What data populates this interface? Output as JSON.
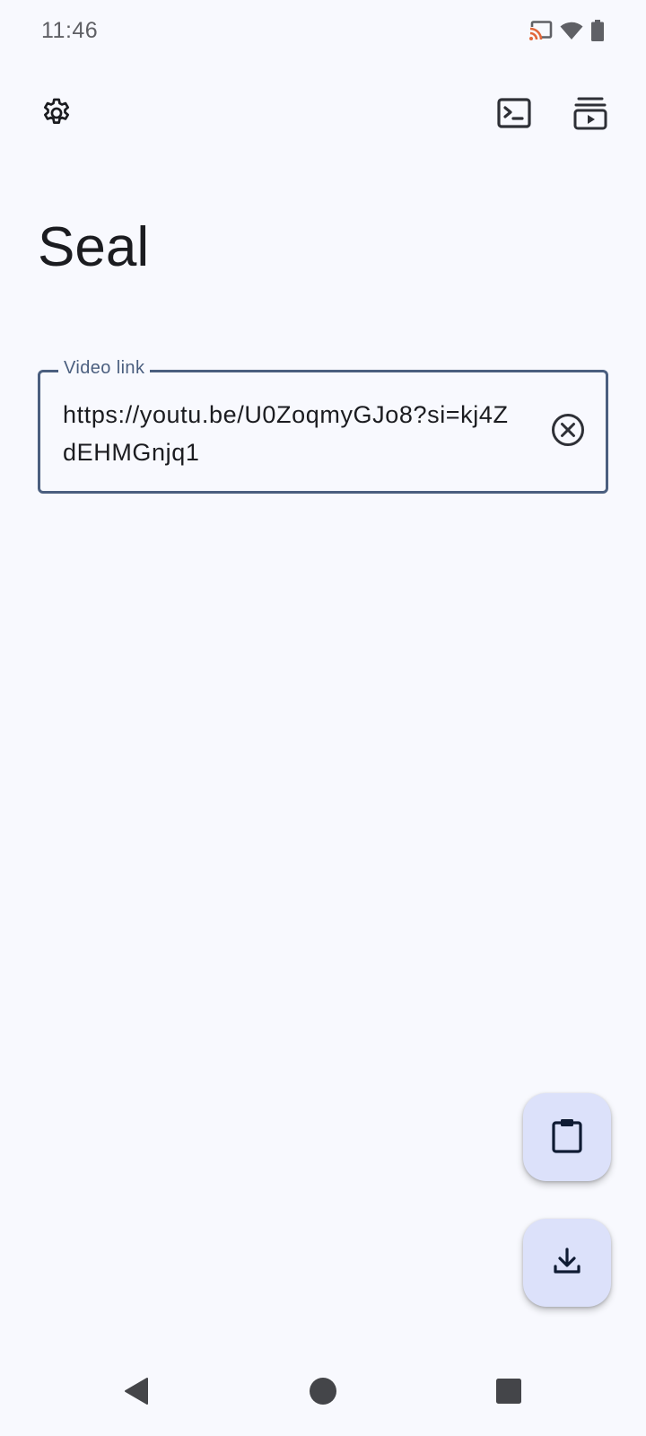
{
  "status_bar": {
    "time": "11:46",
    "icons": [
      "cast-icon",
      "wifi-icon",
      "battery-icon"
    ],
    "cast_color": "#e2673a"
  },
  "top_bar": {
    "left_icon": "gear-icon",
    "right_icons": [
      "terminal-icon",
      "download-queue-icon"
    ]
  },
  "app": {
    "title": "Seal"
  },
  "video_link_field": {
    "label": "Video link",
    "value": "https://youtu.be/U0ZoqmyGJo8?si=kj4ZdEHMGnjq1",
    "clear_icon": "clear-circle-icon"
  },
  "fabs": {
    "paste_icon": "clipboard-icon",
    "download_icon": "download-icon"
  },
  "nav_bar": {
    "buttons": [
      "back-triangle-icon",
      "home-circle-icon",
      "recents-square-icon"
    ]
  },
  "colors": {
    "background": "#f8f9fe",
    "outline": "#4b5f7f",
    "fab_container": "#dce1fa",
    "on_surface": "#1b1c20"
  }
}
